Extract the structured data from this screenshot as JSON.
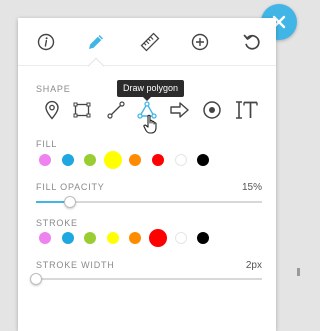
{
  "toolbar": {
    "tools": [
      {
        "name": "info-icon",
        "active": false
      },
      {
        "name": "pencil-icon",
        "active": true
      },
      {
        "name": "ruler-icon",
        "active": false
      },
      {
        "name": "plus-circle-icon",
        "active": false
      },
      {
        "name": "undo-icon",
        "active": false
      }
    ],
    "active_color": "#41b6e6",
    "inactive_color": "#444444"
  },
  "close_button": {
    "icon": "close-icon",
    "color": "#41b6e6"
  },
  "shape": {
    "label": "SHAPE",
    "tooltip": "Draw polygon",
    "selected": "polygon",
    "options": [
      "marker",
      "rectangle",
      "polyline",
      "polygon",
      "arrow",
      "circle",
      "text"
    ]
  },
  "fill": {
    "label": "FILL",
    "colors": [
      "#ee82ee",
      "#1ea7e1",
      "#9acd32",
      "#ffff00",
      "#ff8c00",
      "#ff0000",
      "#ffffff",
      "#000000"
    ],
    "selected_index": 3
  },
  "fill_opacity": {
    "label": "FILL OPACITY",
    "value_text": "15%",
    "value": 0.15
  },
  "stroke": {
    "label": "STROKE",
    "colors": [
      "#ee82ee",
      "#1ea7e1",
      "#9acd32",
      "#ffff00",
      "#ff8c00",
      "#ff0000",
      "#ffffff",
      "#000000"
    ],
    "selected_index": 5
  },
  "stroke_width": {
    "label": "STROKE WIDTH",
    "value_text": "2px",
    "value": 0.0
  }
}
